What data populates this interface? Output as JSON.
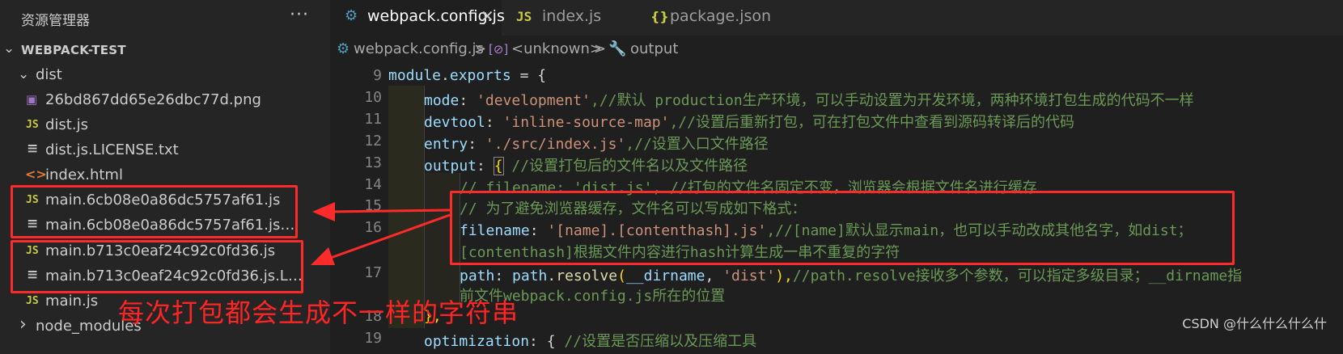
{
  "explorer": {
    "title": "资源管理器",
    "more": "···",
    "root": "WEBPACK-TEST",
    "items": [
      {
        "label": "dist",
        "icon": "chevron-down-icon",
        "glyph": "⌄"
      },
      {
        "label": "26bd867dd65e26dbc77d.png",
        "icon": "image-file-icon",
        "glyph": "▣"
      },
      {
        "label": "dist.js",
        "icon": "js-file-icon",
        "glyph": "JS"
      },
      {
        "label": "dist.js.LICENSE.txt",
        "icon": "text-file-icon",
        "glyph": "≡"
      },
      {
        "label": "index.html",
        "icon": "html-file-icon",
        "glyph": "<>"
      },
      {
        "label": "main.6cb08e0a86dc5757af61.js",
        "icon": "js-file-icon",
        "glyph": "JS"
      },
      {
        "label": "main.6cb08e0a86dc5757af61.js.LICEN...",
        "icon": "text-file-icon",
        "glyph": "≡"
      },
      {
        "label": "main.b713c0eaf24c92c0fd36.js",
        "icon": "js-file-icon",
        "glyph": "JS"
      },
      {
        "label": "main.b713c0eaf24c92c0fd36.js.LICENS...",
        "icon": "text-file-icon",
        "glyph": "≡"
      },
      {
        "label": "main.js",
        "icon": "js-file-icon",
        "glyph": "JS"
      },
      {
        "label": "node_modules",
        "icon": "chevron-right-icon",
        "glyph": "›"
      }
    ]
  },
  "tabs": [
    {
      "label": "webpack.config.js",
      "icon_glyph": "⚙",
      "close": "✕"
    },
    {
      "label": "index.js",
      "icon_glyph": "JS"
    },
    {
      "label": "package.json",
      "icon_glyph": "{}"
    }
  ],
  "breadcrumb": {
    "file": "webpack.config.js",
    "sep": ">",
    "symbol": "<unknown>",
    "symbol_icon": "[⊘]",
    "prop": "output",
    "prop_icon": "🔧"
  },
  "editor": {
    "line_numbers": [
      "9",
      "10",
      "11",
      "12",
      "13",
      "14",
      "15",
      "16",
      "",
      "17",
      "",
      "18",
      "19"
    ],
    "lines": {
      "l9": [
        "module",
        ".",
        "exports",
        " = {"
      ],
      "l10": [
        "mode",
        ": ",
        "'development'",
        ",//默认 production生产环境，可以手动设置为开发环境，两种环境打包生成的代码不一样"
      ],
      "l11": [
        "devtool",
        ": ",
        "'inline-source-map'",
        ",//设置后重新打包，可在打包文件中查看到源码转译后的代码"
      ],
      "l12": [
        "entry",
        ": ",
        "'./src/index.js'",
        ",//设置入口文件路径"
      ],
      "l13": [
        "output",
        ": ",
        "{",
        " //设置打包后的文件名以及文件路径"
      ],
      "l14": [
        "// filename: 'dist.js', //打包的文件名固定不变，浏览器会根据文件名进行缓存"
      ],
      "l15": [
        "// 为了避免浏览器缓存，文件名可以写成如下格式："
      ],
      "l16": [
        "filename",
        ": ",
        "'[name].[contenthash].js'",
        ",//[name]默认显示main，也可以手动改成其他名字，如dist；"
      ],
      "l16b": [
        "[contenthash]根据文件内容进行hash计算生成一串不重复的字符"
      ],
      "l17": [
        "path",
        ": ",
        "path",
        ".",
        "resolve",
        "(",
        "__dirname",
        ", ",
        "'dist'",
        "),",
        "//path.resolve接收多个参数，可以指定多级目录；__dirname指"
      ],
      "l17b": [
        "前文件webpack.config.js所在的位置"
      ],
      "l18": [
        "},"
      ],
      "l19": [
        "optimization",
        ": { ",
        "//设置是否压缩以及压缩工具"
      ]
    }
  },
  "annotation": {
    "text": "每次打包都会生成不一样的字符串"
  },
  "watermark": "CSDN @什么什么什么什"
}
